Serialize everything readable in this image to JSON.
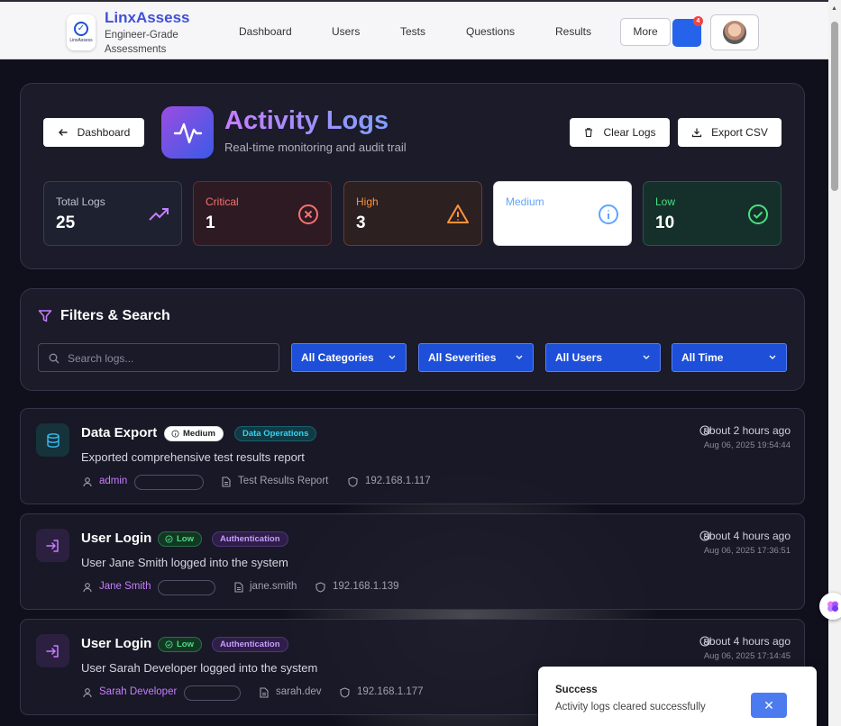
{
  "brand": {
    "name": "LinxAssess",
    "tagline": "Engineer-Grade Assessments",
    "logo_text": "LinxAssess"
  },
  "nav": {
    "items": [
      "Dashboard",
      "Users",
      "Tests",
      "Questions",
      "Results"
    ],
    "more_label": "More",
    "notification_count": "4"
  },
  "header": {
    "back_label": "Dashboard",
    "title": "Activity Logs",
    "subtitle": "Real-time monitoring and audit trail",
    "clear_label": "Clear Logs",
    "export_label": "Export CSV"
  },
  "stats": [
    {
      "label": "Total Logs",
      "value": "25",
      "icon": "trending-up-icon"
    },
    {
      "label": "Critical",
      "value": "1",
      "icon": "x-circle-icon"
    },
    {
      "label": "High",
      "value": "3",
      "icon": "alert-triangle-icon"
    },
    {
      "label": "Medium",
      "value": "",
      "icon": "info-icon"
    },
    {
      "label": "Low",
      "value": "10",
      "icon": "check-circle-icon"
    }
  ],
  "filters": {
    "title": "Filters & Search",
    "search_placeholder": "Search logs...",
    "category": "All Categories",
    "severity": "All Severities",
    "users": "All Users",
    "time": "All Time"
  },
  "logs": [
    {
      "title": "Data Export",
      "severity": "Medium",
      "category": "Data Operations",
      "description": "Exported comprehensive test results report",
      "user": "admin",
      "resource": "Test Results Report",
      "ip": "192.168.1.117",
      "ago": "about 2 hours ago",
      "date": "Aug 06, 2025 19:54:44",
      "icon": "database-icon"
    },
    {
      "title": "User Login",
      "severity": "Low",
      "category": "Authentication",
      "description": "User Jane Smith logged into the system",
      "user": "Jane Smith",
      "resource": "jane.smith",
      "ip": "192.168.1.139",
      "ago": "about 4 hours ago",
      "date": "Aug 06, 2025 17:36:51",
      "icon": "login-icon"
    },
    {
      "title": "User Login",
      "severity": "Low",
      "category": "Authentication",
      "description": "User Sarah Developer logged into the system",
      "user": "Sarah Developer",
      "resource": "sarah.dev",
      "ip": "192.168.1.177",
      "ago": "about 4 hours ago",
      "date": "Aug 06, 2025 17:14:45",
      "icon": "login-icon"
    }
  ],
  "toast": {
    "title": "Success",
    "message": "Activity logs cleared successfully",
    "close": "✕"
  },
  "colors": {
    "accent": "#1d4fd8",
    "purple": "#c77dff",
    "critical": "#f87171",
    "high": "#fb923c",
    "medium": "#60a5fa",
    "low": "#4ade80"
  }
}
